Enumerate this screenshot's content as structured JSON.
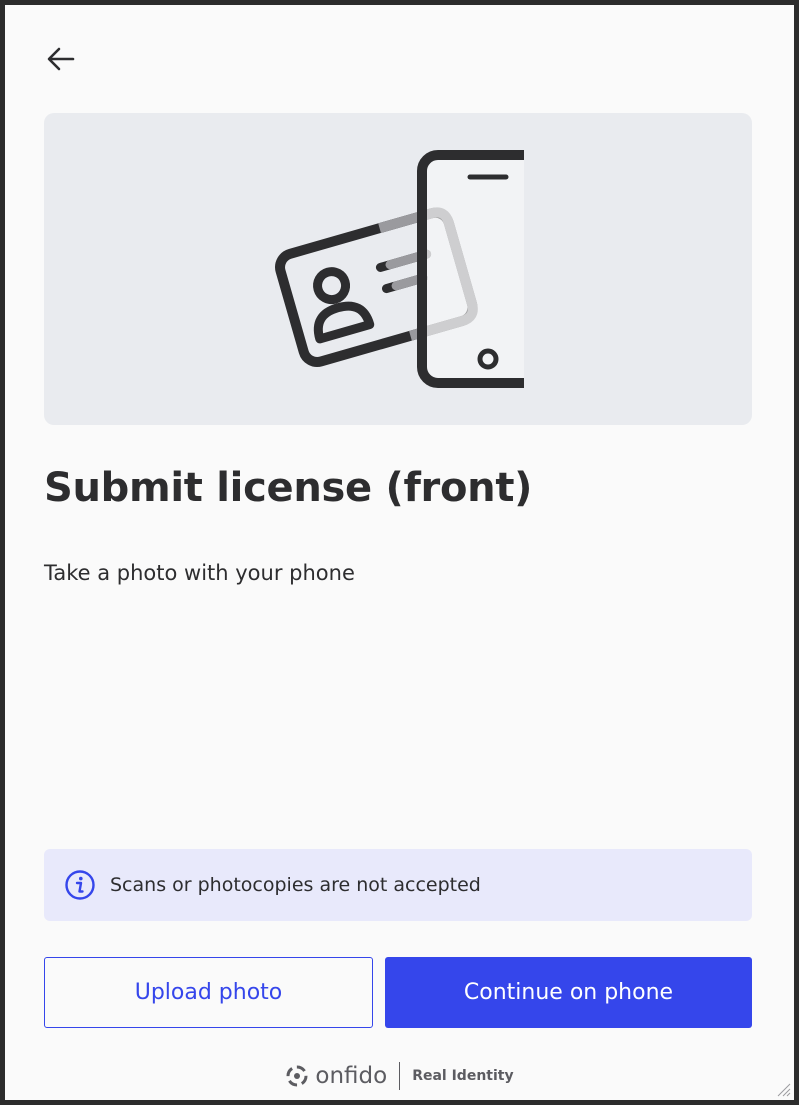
{
  "header": {
    "back_icon": "arrow-left-icon"
  },
  "hero": {
    "illustration": "id-card-and-phone-illustration"
  },
  "title": "Submit license (front)",
  "subtitle": "Take a photo with your phone",
  "notice": {
    "icon": "info-icon",
    "text": "Scans or photocopies are not accepted"
  },
  "actions": {
    "upload_label": "Upload photo",
    "continue_label": "Continue on phone"
  },
  "footer": {
    "brand": "onfido",
    "tagline": "Real Identity",
    "logo_icon": "onfido-logo-icon"
  },
  "colors": {
    "accent": "#3546eb",
    "notice_bg": "#e8e9fb",
    "hero_bg": "#e9ebef",
    "text": "#2d2d2f"
  }
}
